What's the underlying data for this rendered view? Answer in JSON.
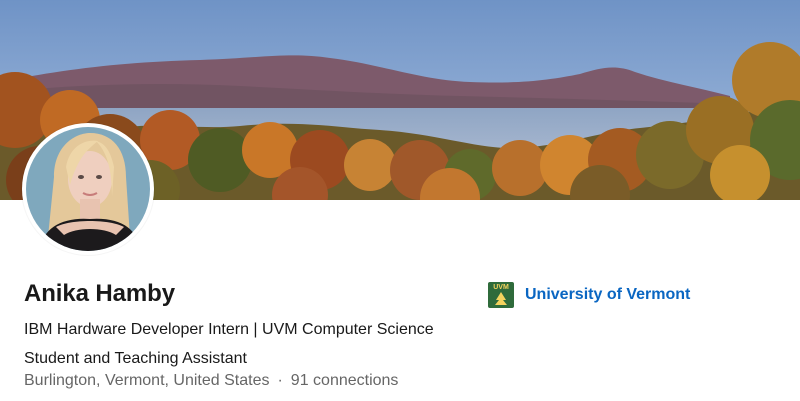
{
  "profile": {
    "name": "Anika Hamby",
    "headline": "IBM Hardware Developer Intern | UVM Computer Science Student and Teaching Assistant",
    "location": "Burlington, Vermont, United States",
    "separator": "·",
    "connections": "91 connections"
  },
  "education": {
    "logo_text": "UVM",
    "school_name": "University of Vermont"
  },
  "banner": {
    "description_icon": "landscape-banner-image"
  },
  "colors": {
    "link_blue": "#0a66c2",
    "text_primary": "#191919",
    "text_secondary": "#666666",
    "uvm_green": "#2f6b3b",
    "uvm_gold": "#f4d35e"
  }
}
